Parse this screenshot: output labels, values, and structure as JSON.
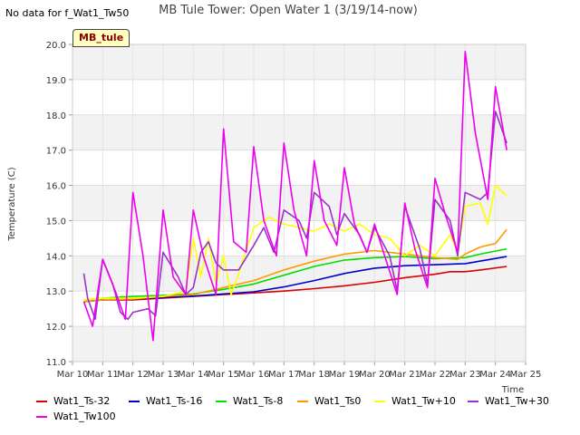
{
  "header": {
    "no_data_text": "No data for f_Wat1_Tw50",
    "site_tag": "MB_tule"
  },
  "chart_data": {
    "type": "line",
    "title": "MB Tule Tower: Open Water 1 (3/19/14-now)",
    "xlabel": "Time",
    "ylabel": "Temperature (C)",
    "ylim": [
      11.0,
      20.0
    ],
    "yticks": [
      "11.0",
      "12.0",
      "13.0",
      "14.0",
      "15.0",
      "16.0",
      "17.0",
      "18.0",
      "19.0",
      "20.0"
    ],
    "xlim": [
      "2014-03-10",
      "2014-03-25"
    ],
    "xticks": [
      "Mar 10",
      "Mar 11",
      "Mar 12",
      "Mar 13",
      "Mar 14",
      "Mar 15",
      "Mar 16",
      "Mar 17",
      "Mar 18",
      "Mar 19",
      "Mar 20",
      "Mar 21",
      "Mar 22",
      "Mar 23",
      "Mar 24",
      "Mar 25"
    ],
    "grid": true,
    "legend_position": "bottom",
    "series": [
      {
        "name": "Wat1_Ts-32",
        "color": "#dd0000",
        "points": [
          [
            "2014-03-10T09:00",
            12.7
          ],
          [
            "2014-03-11",
            12.75
          ],
          [
            "2014-03-12",
            12.75
          ],
          [
            "2014-03-13",
            12.8
          ],
          [
            "2014-03-14",
            12.85
          ],
          [
            "2014-03-15",
            12.9
          ],
          [
            "2014-03-16",
            12.95
          ],
          [
            "2014-03-17",
            13.0
          ],
          [
            "2014-03-18",
            13.07
          ],
          [
            "2014-03-19",
            13.15
          ],
          [
            "2014-03-20",
            13.25
          ],
          [
            "2014-03-21",
            13.38
          ],
          [
            "2014-03-22",
            13.48
          ],
          [
            "2014-03-22T12:00",
            13.55
          ],
          [
            "2014-03-23",
            13.55
          ],
          [
            "2014-03-23T12:00",
            13.6
          ],
          [
            "2014-03-24T09:00",
            13.7
          ]
        ]
      },
      {
        "name": "Wat1_Ts-16",
        "color": "#0000cc",
        "points": [
          [
            "2014-03-10T09:00",
            12.7
          ],
          [
            "2014-03-11",
            12.75
          ],
          [
            "2014-03-12",
            12.78
          ],
          [
            "2014-03-13",
            12.82
          ],
          [
            "2014-03-14",
            12.86
          ],
          [
            "2014-03-15",
            12.92
          ],
          [
            "2014-03-16",
            12.98
          ],
          [
            "2014-03-17",
            13.12
          ],
          [
            "2014-03-18",
            13.3
          ],
          [
            "2014-03-19",
            13.5
          ],
          [
            "2014-03-20",
            13.65
          ],
          [
            "2014-03-21",
            13.72
          ],
          [
            "2014-03-22",
            13.75
          ],
          [
            "2014-03-23",
            13.78
          ],
          [
            "2014-03-24T09:00",
            13.98
          ]
        ]
      },
      {
        "name": "Wat1_Ts-8",
        "color": "#00dd00",
        "points": [
          [
            "2014-03-10T09:00",
            12.75
          ],
          [
            "2014-03-11",
            12.8
          ],
          [
            "2014-03-12",
            12.85
          ],
          [
            "2014-03-13",
            12.88
          ],
          [
            "2014-03-14",
            12.92
          ],
          [
            "2014-03-15",
            13.05
          ],
          [
            "2014-03-16",
            13.2
          ],
          [
            "2014-03-17",
            13.45
          ],
          [
            "2014-03-18",
            13.7
          ],
          [
            "2014-03-19",
            13.88
          ],
          [
            "2014-03-20",
            13.95
          ],
          [
            "2014-03-21",
            13.98
          ],
          [
            "2014-03-22",
            13.92
          ],
          [
            "2014-03-23",
            13.95
          ],
          [
            "2014-03-23T12:00",
            14.05
          ],
          [
            "2014-03-24T09:00",
            14.2
          ]
        ]
      },
      {
        "name": "Wat1_Ts0",
        "color": "#ff9900",
        "points": [
          [
            "2014-03-10T09:00",
            12.7
          ],
          [
            "2014-03-11",
            12.75
          ],
          [
            "2014-03-12",
            12.78
          ],
          [
            "2014-03-13",
            12.85
          ],
          [
            "2014-03-14",
            12.9
          ],
          [
            "2014-03-15",
            13.1
          ],
          [
            "2014-03-16",
            13.3
          ],
          [
            "2014-03-17",
            13.6
          ],
          [
            "2014-03-18",
            13.85
          ],
          [
            "2014-03-19",
            14.05
          ],
          [
            "2014-03-20",
            14.15
          ],
          [
            "2014-03-21",
            14.05
          ],
          [
            "2014-03-22",
            13.95
          ],
          [
            "2014-03-22T18:00",
            13.9
          ],
          [
            "2014-03-23",
            14.05
          ],
          [
            "2014-03-23T12:00",
            14.25
          ],
          [
            "2014-03-24",
            14.35
          ],
          [
            "2014-03-24T09:00",
            14.75
          ]
        ]
      },
      {
        "name": "Wat1_Tw+10",
        "color": "#ffff00",
        "points": [
          [
            "2014-03-10T09:00",
            12.75
          ],
          [
            "2014-03-11",
            12.8
          ],
          [
            "2014-03-12",
            12.8
          ],
          [
            "2014-03-13",
            12.85
          ],
          [
            "2014-03-13T18:00",
            13.0
          ],
          [
            "2014-03-14",
            14.5
          ],
          [
            "2014-03-14T06:00",
            13.4
          ],
          [
            "2014-03-14T12:00",
            14.5
          ],
          [
            "2014-03-14T18:00",
            13.2
          ],
          [
            "2014-03-15",
            14.0
          ],
          [
            "2014-03-15T06:00",
            12.9
          ],
          [
            "2014-03-15T12:00",
            13.5
          ],
          [
            "2014-03-16",
            14.8
          ],
          [
            "2014-03-16T12:00",
            15.1
          ],
          [
            "2014-03-17",
            14.9
          ],
          [
            "2014-03-17T12:00",
            14.8
          ],
          [
            "2014-03-18",
            14.7
          ],
          [
            "2014-03-18T12:00",
            14.9
          ],
          [
            "2014-03-19",
            14.7
          ],
          [
            "2014-03-19T12:00",
            14.9
          ],
          [
            "2014-03-20",
            14.6
          ],
          [
            "2014-03-20T12:00",
            14.5
          ],
          [
            "2014-03-21",
            14.0
          ],
          [
            "2014-03-21T12:00",
            14.3
          ],
          [
            "2014-03-22",
            14.0
          ],
          [
            "2014-03-22T12:00",
            14.6
          ],
          [
            "2014-03-22T18:00",
            14.1
          ],
          [
            "2014-03-23",
            15.4
          ],
          [
            "2014-03-23T12:00",
            15.5
          ],
          [
            "2014-03-23T18:00",
            14.9
          ],
          [
            "2014-03-24",
            16.0
          ],
          [
            "2014-03-24T09:00",
            15.7
          ]
        ]
      },
      {
        "name": "Wat1_Tw+30",
        "color": "#9933cc",
        "points": [
          [
            "2014-03-10T09:00",
            13.5
          ],
          [
            "2014-03-10T12:00",
            12.8
          ],
          [
            "2014-03-10T18:00",
            12.2
          ],
          [
            "2014-03-11",
            13.9
          ],
          [
            "2014-03-11T08:00",
            13.2
          ],
          [
            "2014-03-11T14:00",
            12.4
          ],
          [
            "2014-03-11T20:00",
            12.2
          ],
          [
            "2014-03-12",
            12.4
          ],
          [
            "2014-03-12T12:00",
            12.5
          ],
          [
            "2014-03-12T18:00",
            12.3
          ],
          [
            "2014-03-13",
            14.1
          ],
          [
            "2014-03-13T12:00",
            13.4
          ],
          [
            "2014-03-13T18:00",
            12.9
          ],
          [
            "2014-03-14",
            13.1
          ],
          [
            "2014-03-14T06:00",
            14.1
          ],
          [
            "2014-03-14T12:00",
            14.4
          ],
          [
            "2014-03-14T18:00",
            13.8
          ],
          [
            "2014-03-15",
            13.6
          ],
          [
            "2014-03-15T12:00",
            13.6
          ],
          [
            "2014-03-16",
            14.3
          ],
          [
            "2014-03-16T08:00",
            14.8
          ],
          [
            "2014-03-16T16:00",
            14.1
          ],
          [
            "2014-03-17",
            15.3
          ],
          [
            "2014-03-17T12:00",
            15.0
          ],
          [
            "2014-03-17T18:00",
            14.5
          ],
          [
            "2014-03-18",
            15.8
          ],
          [
            "2014-03-18T12:00",
            15.4
          ],
          [
            "2014-03-18T18:00",
            14.6
          ],
          [
            "2014-03-19",
            15.2
          ],
          [
            "2014-03-19T12:00",
            14.6
          ],
          [
            "2014-03-19T18:00",
            14.1
          ],
          [
            "2014-03-20",
            14.8
          ],
          [
            "2014-03-20T12:00",
            14.0
          ],
          [
            "2014-03-20T18:00",
            13.0
          ],
          [
            "2014-03-21",
            15.4
          ],
          [
            "2014-03-21T12:00",
            14.2
          ],
          [
            "2014-03-21T18:00",
            13.2
          ],
          [
            "2014-03-22",
            15.6
          ],
          [
            "2014-03-22T12:00",
            15.0
          ],
          [
            "2014-03-22T18:00",
            14.0
          ],
          [
            "2014-03-23",
            15.8
          ],
          [
            "2014-03-23T12:00",
            15.6
          ],
          [
            "2014-03-23T18:00",
            15.8
          ],
          [
            "2014-03-24",
            18.1
          ],
          [
            "2014-03-24T09:00",
            17.2
          ]
        ]
      },
      {
        "name": "Wat1_Tw100",
        "color": "#ee00ee",
        "points": [
          [
            "2014-03-10T09:00",
            12.7
          ],
          [
            "2014-03-10T16:00",
            12.0
          ],
          [
            "2014-03-11",
            13.9
          ],
          [
            "2014-03-11T10:00",
            13.0
          ],
          [
            "2014-03-11T18:00",
            12.2
          ],
          [
            "2014-03-12",
            15.8
          ],
          [
            "2014-03-12T08:00",
            14.0
          ],
          [
            "2014-03-12T16:00",
            11.6
          ],
          [
            "2014-03-13",
            15.3
          ],
          [
            "2014-03-13T08:00",
            13.4
          ],
          [
            "2014-03-13T18:00",
            12.9
          ],
          [
            "2014-03-14",
            15.3
          ],
          [
            "2014-03-14T08:00",
            14.0
          ],
          [
            "2014-03-14T18:00",
            12.9
          ],
          [
            "2014-03-15",
            17.6
          ],
          [
            "2014-03-15T08:00",
            14.4
          ],
          [
            "2014-03-15T18:00",
            14.1
          ],
          [
            "2014-03-16",
            17.1
          ],
          [
            "2014-03-16T08:00",
            15.0
          ],
          [
            "2014-03-16T18:00",
            14.0
          ],
          [
            "2014-03-17",
            17.2
          ],
          [
            "2014-03-17T08:00",
            15.3
          ],
          [
            "2014-03-17T18:00",
            14.0
          ],
          [
            "2014-03-18",
            16.7
          ],
          [
            "2014-03-18T08:00",
            15.0
          ],
          [
            "2014-03-18T18:00",
            14.3
          ],
          [
            "2014-03-19",
            16.5
          ],
          [
            "2014-03-19T08:00",
            14.9
          ],
          [
            "2014-03-19T18:00",
            14.1
          ],
          [
            "2014-03-20",
            14.9
          ],
          [
            "2014-03-20T08:00",
            14.0
          ],
          [
            "2014-03-20T18:00",
            12.9
          ],
          [
            "2014-03-21",
            15.5
          ],
          [
            "2014-03-21T08:00",
            14.2
          ],
          [
            "2014-03-21T18:00",
            13.1
          ],
          [
            "2014-03-22",
            16.2
          ],
          [
            "2014-03-22T08:00",
            15.2
          ],
          [
            "2014-03-22T18:00",
            14.1
          ],
          [
            "2014-03-23",
            19.8
          ],
          [
            "2014-03-23T08:00",
            17.5
          ],
          [
            "2014-03-23T18:00",
            15.6
          ],
          [
            "2014-03-24",
            18.8
          ],
          [
            "2014-03-24T09:00",
            17.0
          ]
        ]
      }
    ]
  }
}
